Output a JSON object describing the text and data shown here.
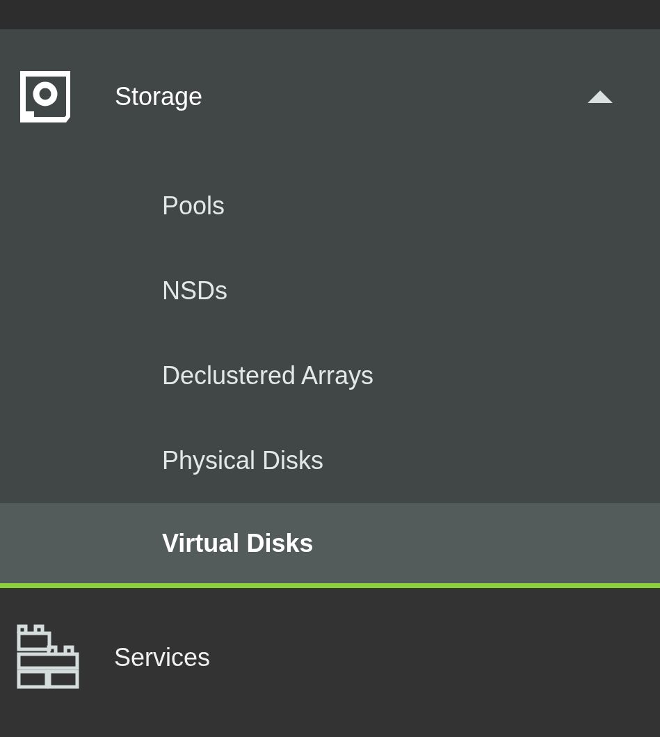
{
  "nav": [
    {
      "label": "Storage",
      "expanded": true,
      "children": [
        {
          "label": "Pools",
          "selected": false
        },
        {
          "label": "NSDs",
          "selected": false
        },
        {
          "label": "Declustered Arrays",
          "selected": false
        },
        {
          "label": "Physical Disks",
          "selected": false
        },
        {
          "label": "Virtual Disks",
          "selected": true
        }
      ]
    },
    {
      "label": "Services",
      "expanded": false
    }
  ]
}
